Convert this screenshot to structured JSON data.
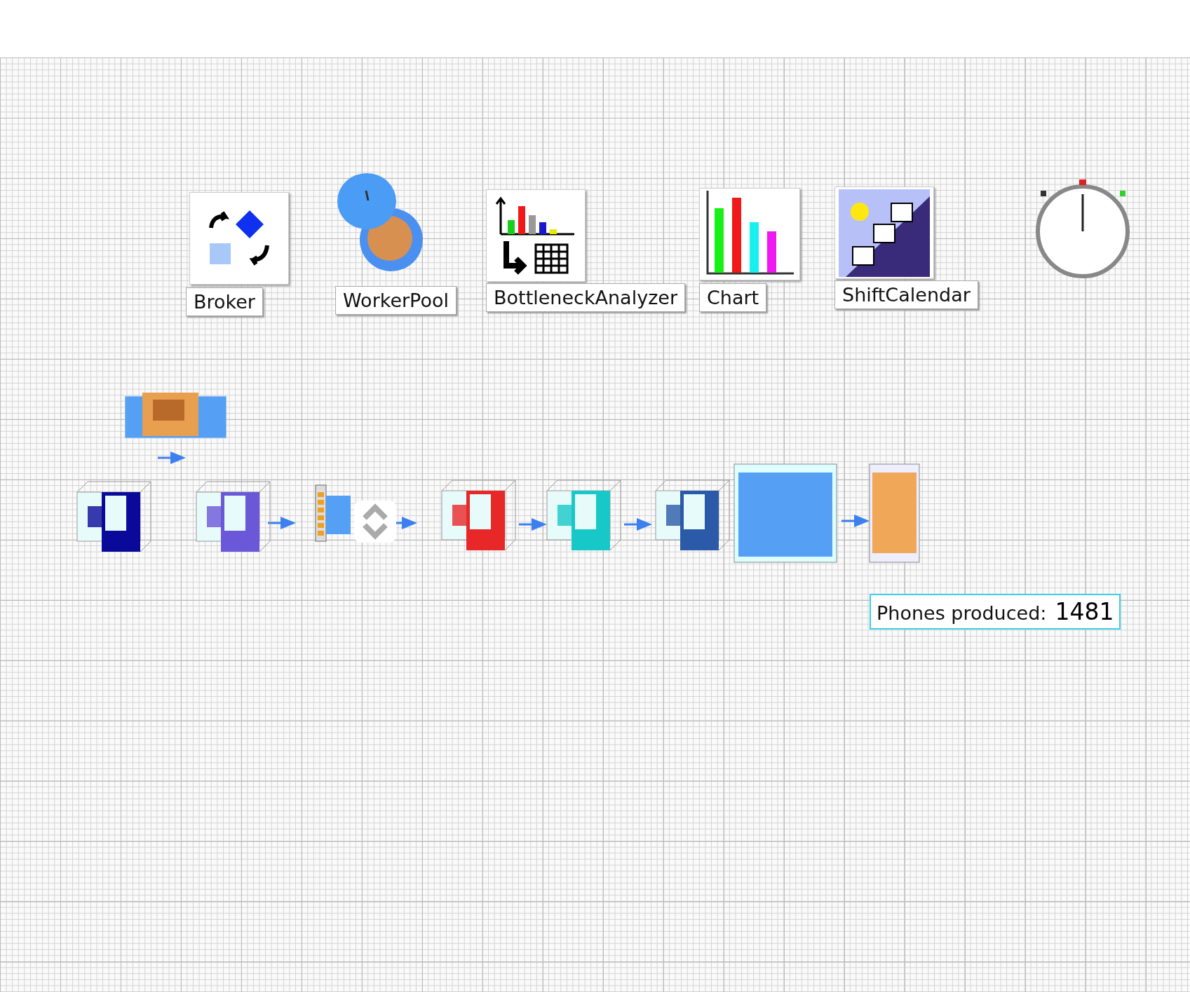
{
  "tools": [
    {
      "kind": "broker",
      "label": "Broker"
    },
    {
      "kind": "workerpool",
      "label": "WorkerPool"
    },
    {
      "kind": "bottleneck",
      "label": "BottleneckAnalyzer"
    },
    {
      "kind": "chart",
      "label": "Chart"
    },
    {
      "kind": "shiftcalendar",
      "label": "ShiftCalendar"
    }
  ],
  "stations": [
    {
      "kind": "source",
      "color": "#e8a050"
    },
    {
      "kind": "machine",
      "color": "#0a0a9a"
    },
    {
      "kind": "machine",
      "color": "#6a58d8"
    },
    {
      "kind": "conveyor",
      "color": "#55a0f5"
    },
    {
      "kind": "assembly",
      "color": "#aaaaaa"
    },
    {
      "kind": "machine",
      "color": "#e82828"
    },
    {
      "kind": "machine",
      "color": "#18c8c8"
    },
    {
      "kind": "machine",
      "color": "#2a5aa8"
    },
    {
      "kind": "buffer",
      "color": "#55a0f5"
    },
    {
      "kind": "drain",
      "color": "#f0a858"
    }
  ],
  "counter": {
    "label": "Phones produced:",
    "value": "1481"
  }
}
